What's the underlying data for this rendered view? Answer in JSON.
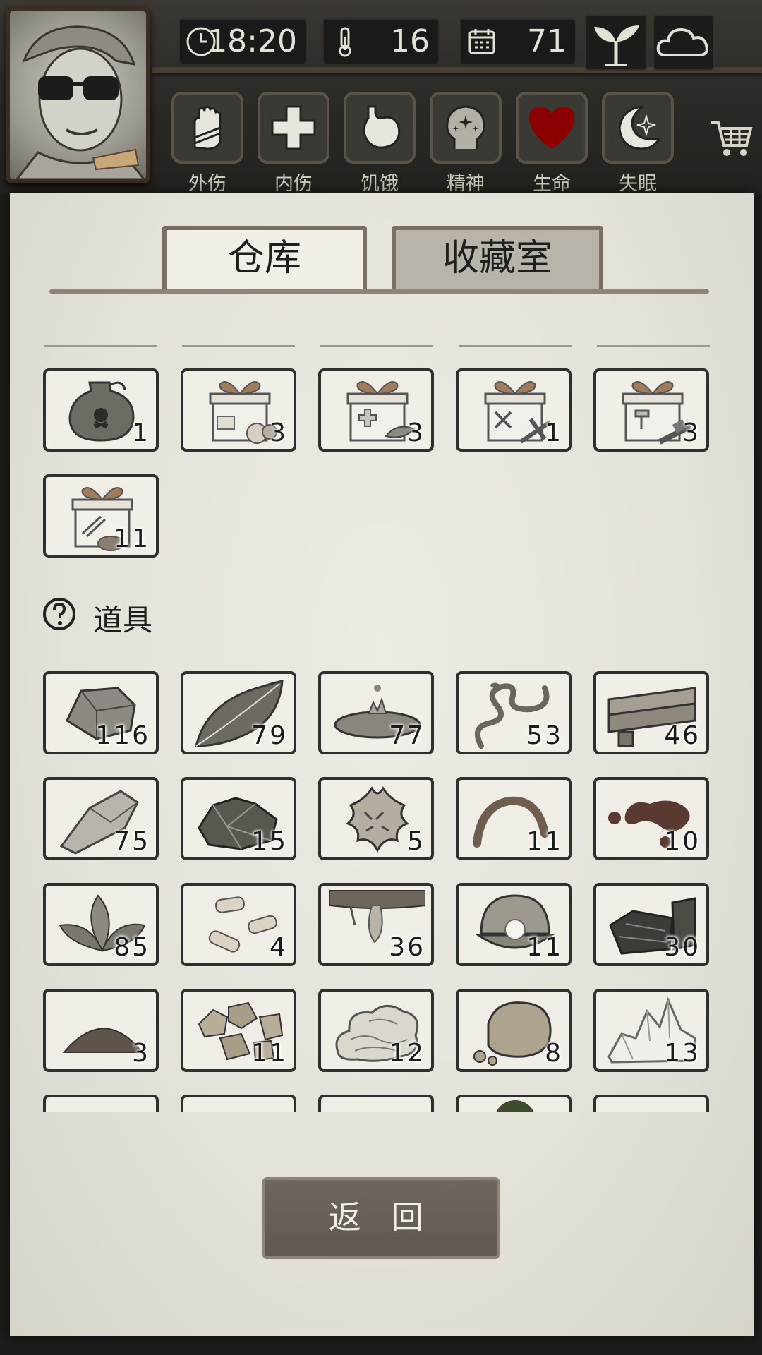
{
  "hud": {
    "time": "18:20",
    "temperature": "16",
    "day": "71"
  },
  "status_bar": [
    {
      "label": "外伤",
      "icon": "bandaged-hand-icon"
    },
    {
      "label": "内伤",
      "icon": "cross-icon"
    },
    {
      "label": "饥饿",
      "icon": "stomach-icon"
    },
    {
      "label": "精神",
      "icon": "head-stars-icon"
    },
    {
      "label": "生命",
      "icon": "heart-icon"
    },
    {
      "label": "失眠",
      "icon": "moon-star-icon"
    }
  ],
  "colors": {
    "heart": "#8b0000"
  },
  "tabs": {
    "warehouse": "仓库",
    "collection": "收藏室"
  },
  "section_tools": "道具",
  "containers": [
    {
      "icon": "skull-jar-icon",
      "count": "1"
    },
    {
      "icon": "food-gift-box-icon",
      "count": "3"
    },
    {
      "icon": "medical-gift-box-icon",
      "count": "3"
    },
    {
      "icon": "tool-gift-box-icon",
      "count": "1"
    },
    {
      "icon": "hammer-gift-box-icon",
      "count": "3"
    },
    {
      "icon": "arrow-gift-box-icon",
      "count": "11"
    }
  ],
  "tools": [
    {
      "icon": "stone-icon",
      "count": "116"
    },
    {
      "icon": "leaf-icon",
      "count": "79"
    },
    {
      "icon": "water-puddle-icon",
      "count": "77"
    },
    {
      "icon": "vine-icon",
      "count": "53"
    },
    {
      "icon": "wood-planks-icon",
      "count": "46"
    },
    {
      "icon": "flint-icon",
      "count": "75"
    },
    {
      "icon": "ore-icon",
      "count": "15"
    },
    {
      "icon": "animal-hide-icon",
      "count": "5"
    },
    {
      "icon": "worm-icon",
      "count": "11"
    },
    {
      "icon": "blood-icon",
      "count": "10"
    },
    {
      "icon": "herb-icon",
      "count": "85"
    },
    {
      "icon": "bone-pieces-icon",
      "count": "4"
    },
    {
      "icon": "tree-resin-icon",
      "count": "36"
    },
    {
      "icon": "pearl-icon",
      "count": "11"
    },
    {
      "icon": "coal-icon",
      "count": "30"
    },
    {
      "icon": "soil-icon",
      "count": "3"
    },
    {
      "icon": "gold-nuggets-icon",
      "count": "11"
    },
    {
      "icon": "wool-icon",
      "count": "12"
    },
    {
      "icon": "sandstone-icon",
      "count": "8"
    },
    {
      "icon": "salt-crystal-icon",
      "count": "13"
    }
  ],
  "back_button": "返 回"
}
